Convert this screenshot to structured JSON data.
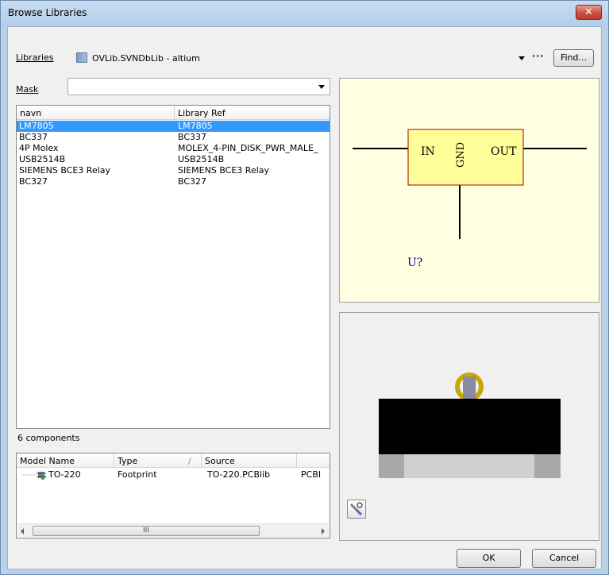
{
  "window": {
    "title": "Browse Libraries",
    "close_glyph": "✕"
  },
  "libraries": {
    "label": "Libraries",
    "value": "OVLib.SVNDbLib - altium",
    "icon": "library-icon",
    "more_label": "···",
    "find_label": "Find..."
  },
  "mask": {
    "label": "Mask",
    "value": ""
  },
  "components": {
    "columns": [
      "navn",
      "Library Ref"
    ],
    "rows": [
      {
        "navn": "LM7805",
        "ref": "LM7805",
        "selected": true
      },
      {
        "navn": "BC337",
        "ref": "BC337",
        "selected": false
      },
      {
        "navn": "4P Molex",
        "ref": "MOLEX_4-PIN_DISK_PWR_MALE_",
        "selected": false
      },
      {
        "navn": "USB2514B",
        "ref": "USB2514B",
        "selected": false
      },
      {
        "navn": "SIEMENS BCE3 Relay",
        "ref": "SIEMENS BCE3 Relay",
        "selected": false
      },
      {
        "navn": "BC327",
        "ref": "BC327",
        "selected": false
      }
    ],
    "count_text": "6 components"
  },
  "models": {
    "columns": [
      "Model Name",
      "Type",
      "Source"
    ],
    "sort_glyph": "/",
    "row": {
      "name": "TO-220",
      "type": "Footprint",
      "source": "TO-220.PCBlib",
      "extra": "PCBI"
    },
    "scroll_thumb_grip": "III"
  },
  "symbol": {
    "pin_in": "IN",
    "pin_gnd": "GND",
    "pin_out": "OUT",
    "designator": "U?",
    "colors": {
      "body": "#ffff99",
      "outline": "#aa0000",
      "text": "#000080",
      "background": "#ffffe1"
    }
  },
  "footprint": {
    "tool_icon": "hammer-wrench-icon",
    "colors": {
      "pad": "#c8a800",
      "body": "#000000",
      "leg": "#8a8aa0"
    }
  },
  "buttons": {
    "ok": "OK",
    "cancel": "Cancel"
  }
}
